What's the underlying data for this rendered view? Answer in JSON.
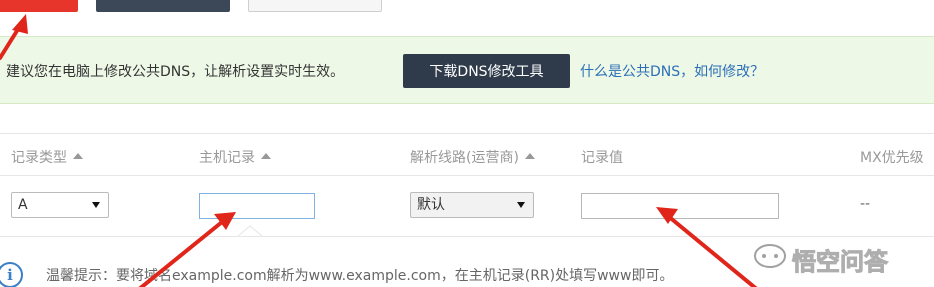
{
  "notice": {
    "text": "建议您在电脑上修改公共DNS，让解析设置实时生效。",
    "download_button": "下载DNS修改工具",
    "help_link": "什么是公共DNS，如何修改？"
  },
  "table": {
    "headers": [
      "记录类型",
      "主机记录",
      "解析线路(运营商)",
      "记录值",
      "MX优先级"
    ],
    "row": {
      "record_type": "A",
      "host": "",
      "line": "默认",
      "value": "",
      "mx": "--"
    }
  },
  "tip": {
    "text": "温馨提示：要将域名example.com解析为www.example.com，在主机记录(RR)处填写www即可。"
  },
  "watermark": {
    "text": "悟空问答",
    "icon": "wukong-logo"
  },
  "colors": {
    "accent_red": "#e8352b",
    "dark_button": "#2f3b4b",
    "link_blue": "#2b6fb6",
    "notice_bg": "#eef8e7",
    "annotation_arrow": "#e0261b"
  }
}
